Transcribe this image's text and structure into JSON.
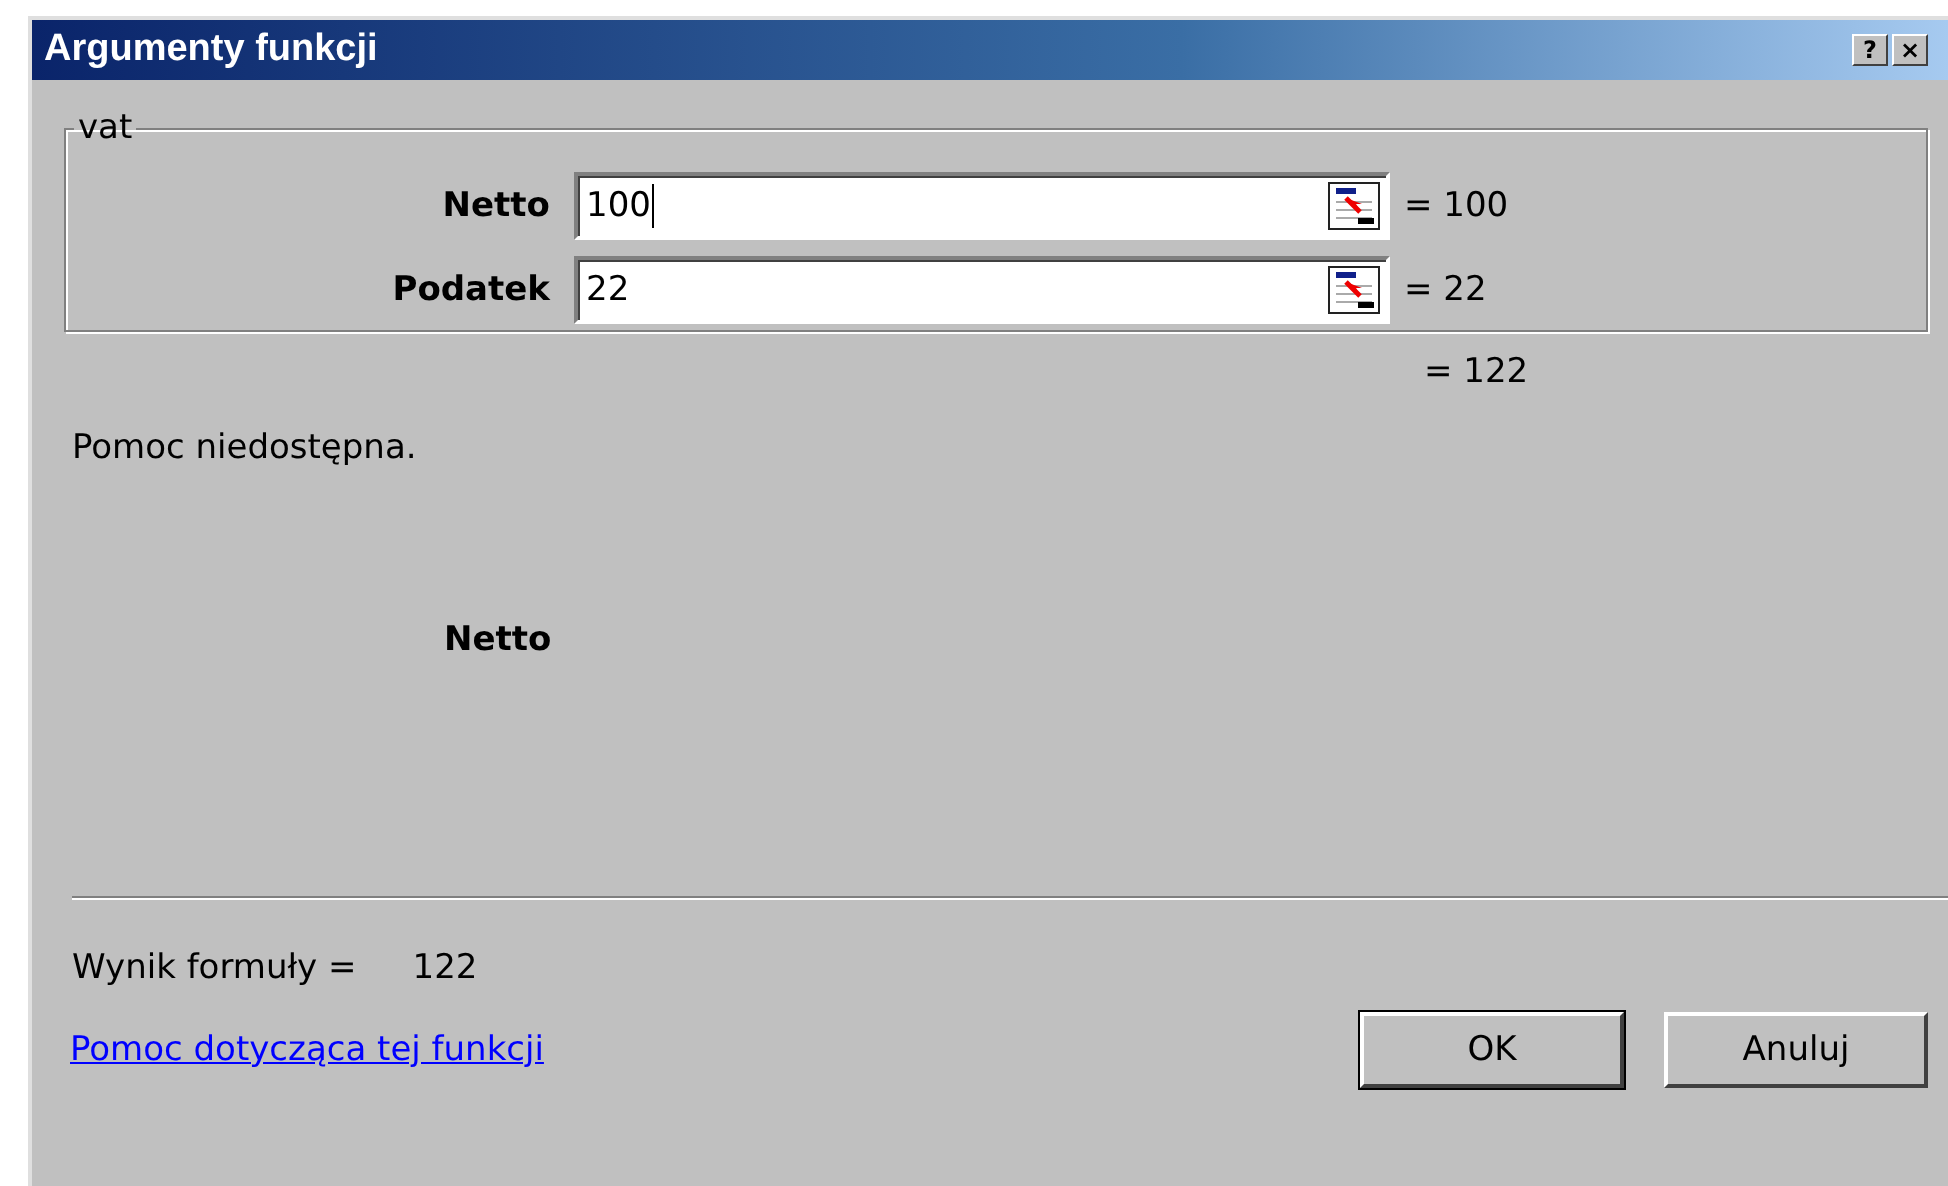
{
  "window": {
    "title": "Argumenty funkcji",
    "title_buttons": [
      "?",
      "×"
    ]
  },
  "group": {
    "legend": "vat",
    "arguments": [
      {
        "label": "Netto",
        "value": "100",
        "focused": true,
        "result": "= 100"
      },
      {
        "label": "Podatek",
        "value": "22",
        "focused": false,
        "result": "= 22"
      }
    ]
  },
  "total": "= 122",
  "help_text": "Pomoc niedostępna.",
  "argument_name": "Netto",
  "formula_result": {
    "label": "Wynik formuły =",
    "value": "122"
  },
  "help_link": "Pomoc dotycząca tej funkcji",
  "buttons": [
    {
      "label": "OK",
      "default": true
    },
    {
      "label": "Anuluj",
      "default": false
    }
  ]
}
